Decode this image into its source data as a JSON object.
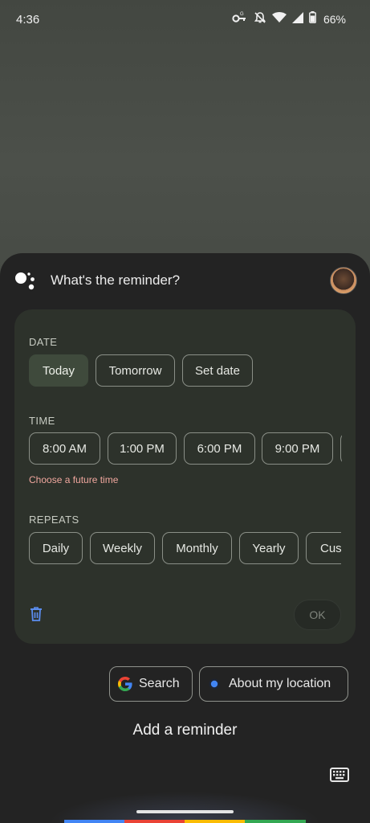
{
  "status_bar": {
    "time": "4:36",
    "battery": "66%"
  },
  "assistant": {
    "prompt": "What's the reminder?",
    "date": {
      "label": "DATE",
      "options": [
        "Today",
        "Tomorrow",
        "Set date"
      ],
      "selected": "Today"
    },
    "time": {
      "label": "TIME",
      "options": [
        "8:00 AM",
        "1:00 PM",
        "6:00 PM",
        "9:00 PM"
      ],
      "error": "Choose a future time"
    },
    "repeats": {
      "label": "REPEATS",
      "options": [
        "Daily",
        "Weekly",
        "Monthly",
        "Yearly",
        "Custom"
      ]
    },
    "ok_label": "OK",
    "suggestions": {
      "search": "Search",
      "location": "About my location"
    },
    "transcript": "Add a reminder"
  },
  "colors": {
    "google_blue": "#4285f4",
    "google_red": "#ea4335",
    "google_yellow": "#fbbc04",
    "google_green": "#34a853",
    "error": "#f0a79e",
    "selected_chip": "#3f4a3c"
  },
  "icons": [
    "gmail-alert-icon",
    "key-icon",
    "notifications-off-icon",
    "wifi-icon",
    "signal-icon",
    "battery-icon",
    "assistant-logo-icon",
    "delete-icon",
    "google-g-icon",
    "location-dot-icon",
    "keyboard-icon"
  ]
}
